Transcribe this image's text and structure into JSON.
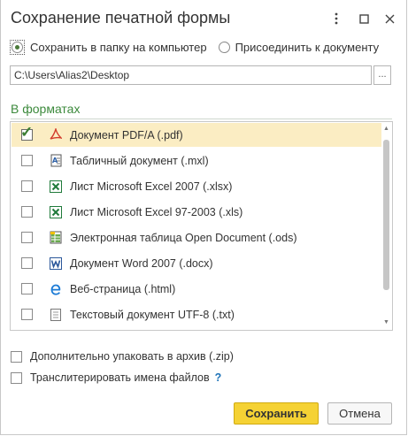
{
  "window": {
    "title": "Сохранение печатной формы",
    "menu_icon": "more-vertical-icon",
    "maximize_icon": "maximize-icon",
    "close_icon": "close-icon"
  },
  "destination": {
    "option_save_folder": "Сохранить в папку на компьютер",
    "option_attach": "Присоединить к документу",
    "selected": "option_save_folder"
  },
  "path": {
    "value": "C:\\Users\\Alias2\\Desktop",
    "browse_label": "..."
  },
  "formats": {
    "heading": "В форматах",
    "items": [
      {
        "label": "Документ PDF/A (.pdf)",
        "icon": "pdf-icon",
        "checked": true
      },
      {
        "label": "Табличный документ (.mxl)",
        "icon": "spreadsheet-doc-icon",
        "checked": false
      },
      {
        "label": "Лист Microsoft Excel 2007 (.xlsx)",
        "icon": "excel-icon",
        "checked": false
      },
      {
        "label": "Лист Microsoft Excel 97-2003 (.xls)",
        "icon": "excel-icon",
        "checked": false
      },
      {
        "label": "Электронная таблица Open Document (.ods)",
        "icon": "ods-icon",
        "checked": false
      },
      {
        "label": "Документ Word 2007 (.docx)",
        "icon": "word-icon",
        "checked": false
      },
      {
        "label": "Веб-страница (.html)",
        "icon": "web-page-icon",
        "checked": false
      },
      {
        "label": "Текстовый документ UTF-8 (.txt)",
        "icon": "text-doc-icon",
        "checked": false
      }
    ]
  },
  "options": {
    "zip_label": "Дополнительно упаковать в архив (.zip)",
    "translit_label": "Транслитерировать имена файлов",
    "help_mark": "?"
  },
  "buttons": {
    "save": "Сохранить",
    "cancel": "Отмена"
  }
}
